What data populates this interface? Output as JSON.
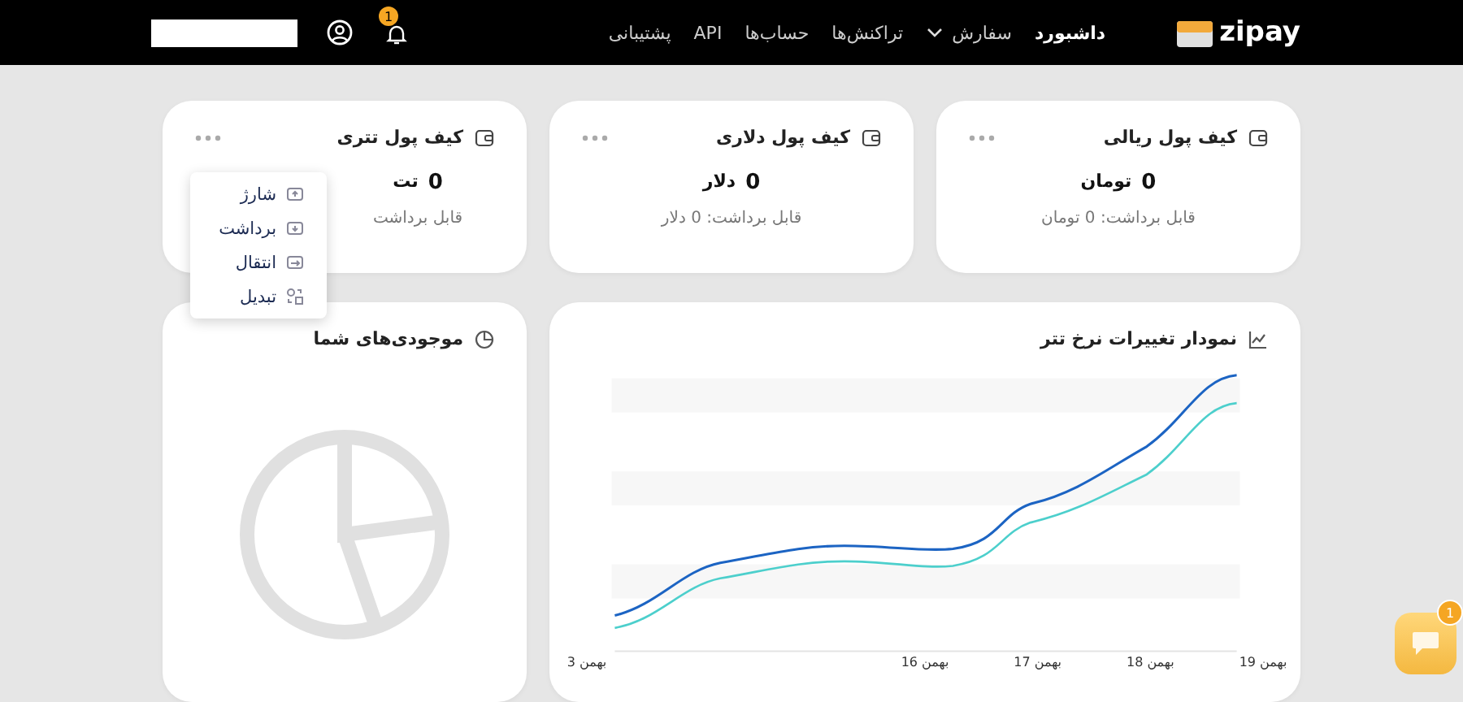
{
  "header": {
    "logo": "zipay",
    "nav": [
      {
        "label": "داشبورد",
        "selected": true,
        "dropdown": false
      },
      {
        "label": "سفارش",
        "selected": false,
        "dropdown": true
      },
      {
        "label": "تراکنش‌ها",
        "selected": false,
        "dropdown": false
      },
      {
        "label": "حساب‌ها",
        "selected": false,
        "dropdown": false
      },
      {
        "label": "API",
        "selected": false,
        "dropdown": false
      },
      {
        "label": "پشتیبانی",
        "selected": false,
        "dropdown": false
      }
    ],
    "notifications": "1"
  },
  "wallets": [
    {
      "title": "کیف پول ریالی",
      "amount": "0",
      "unit": "تومان",
      "caption": "قابل برداشت: 0 تومان",
      "menu_open": false
    },
    {
      "title": "کیف پول دلاری",
      "amount": "0",
      "unit": "دلار",
      "caption": "قابل برداشت: 0 دلار",
      "menu_open": false
    },
    {
      "title": "کیف پول تتری",
      "amount": "0",
      "unit": "تت",
      "caption": "قابل برداشت",
      "menu_open": true
    }
  ],
  "wallet_menu": [
    {
      "label": "شارژ",
      "kind": "charge"
    },
    {
      "label": "برداشت",
      "kind": "withdraw"
    },
    {
      "label": "انتقال",
      "kind": "transfer"
    },
    {
      "label": "تبدیل",
      "kind": "convert"
    }
  ],
  "chart_card": {
    "title": "نمودار تغییرات نرخ تتر",
    "x_labels": [
      "بهمن 19",
      "بهمن 18",
      "بهمن 17",
      "بهمن 16",
      "بهمن 3"
    ]
  },
  "balances_card": {
    "title": "موجودی‌های شما"
  },
  "chat": {
    "badge": "1"
  }
}
